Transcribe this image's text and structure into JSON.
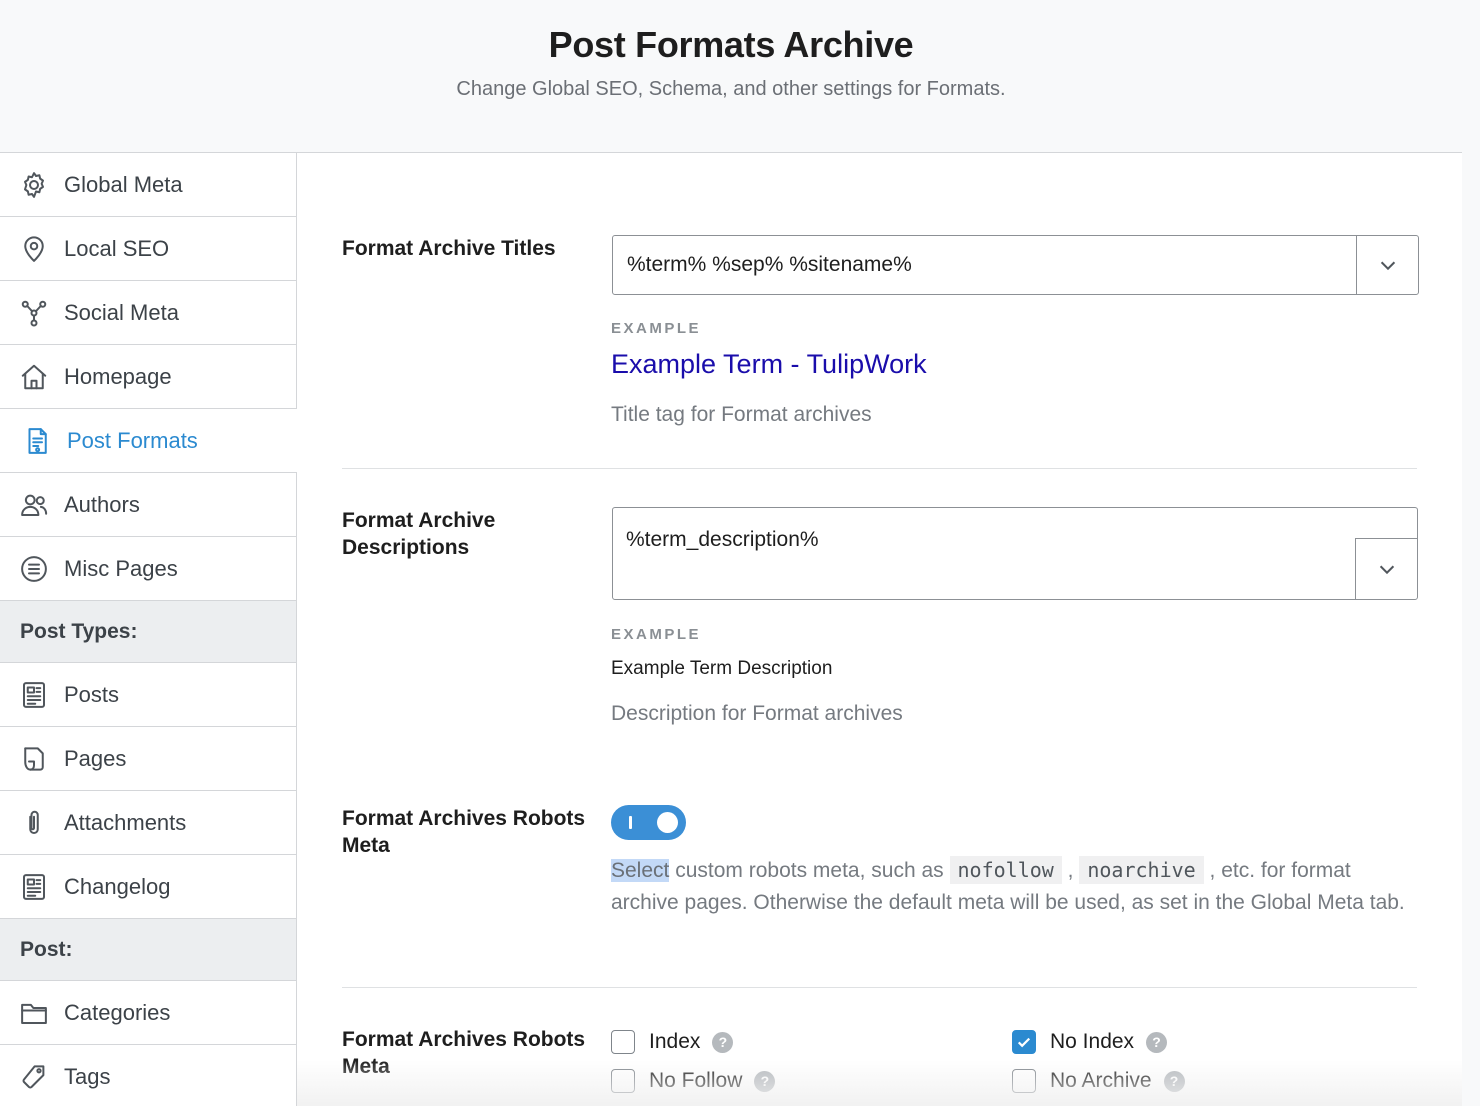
{
  "header": {
    "title": "Post Formats Archive",
    "subtitle": "Change Global SEO, Schema, and other settings for Formats."
  },
  "sidebar": {
    "items": [
      {
        "label": "Global Meta",
        "icon": "gear-icon"
      },
      {
        "label": "Local SEO",
        "icon": "location-pin-icon"
      },
      {
        "label": "Social Meta",
        "icon": "share-network-icon"
      },
      {
        "label": "Homepage",
        "icon": "home-icon"
      },
      {
        "label": "Post Formats",
        "icon": "document-format-icon",
        "active": true
      },
      {
        "label": "Authors",
        "icon": "users-icon"
      },
      {
        "label": "Misc Pages",
        "icon": "list-circle-icon"
      }
    ],
    "section_post_types": "Post Types:",
    "post_types": [
      {
        "label": "Posts",
        "icon": "newspaper-icon"
      },
      {
        "label": "Pages",
        "icon": "page-icon"
      },
      {
        "label": "Attachments",
        "icon": "paperclip-icon"
      },
      {
        "label": "Changelog",
        "icon": "newspaper-icon"
      }
    ],
    "section_post": "Post:",
    "post": [
      {
        "label": "Categories",
        "icon": "folder-icon"
      },
      {
        "label": "Tags",
        "icon": "tag-icon"
      }
    ]
  },
  "titles": {
    "label": "Format Archive Titles",
    "value": "%term% %sep% %sitename%",
    "example_tag": "EXAMPLE",
    "example": "Example Term - TulipWork",
    "help": "Title tag for Format archives"
  },
  "descriptions": {
    "label_line1": "Format Archive",
    "label_line2": "Descriptions",
    "value": "%term_description%",
    "example_tag": "EXAMPLE",
    "example": "Example Term Description",
    "help": "Description for Format archives"
  },
  "robots_toggle": {
    "label_line1": "Format Archives Robots",
    "label_line2": "Meta",
    "enabled": true,
    "help_select": "Select",
    "help_part1": " custom robots meta, such as ",
    "code1": "nofollow",
    "help_sep": " , ",
    "code2": "noarchive",
    "help_part2": " , etc. for format archive pages. Otherwise the default meta will be used, as set in the Global Meta tab."
  },
  "robots_options": {
    "label_line1": "Format Archives Robots",
    "label_line2": "Meta",
    "options": [
      {
        "label": "Index",
        "checked": false
      },
      {
        "label": "No Index",
        "checked": true
      },
      {
        "label": "No Follow",
        "checked": false
      },
      {
        "label": "No Archive",
        "checked": false
      }
    ],
    "help_glyph": "?"
  },
  "colors": {
    "accent": "#2b8ad0",
    "example_link": "#1a0dab"
  }
}
